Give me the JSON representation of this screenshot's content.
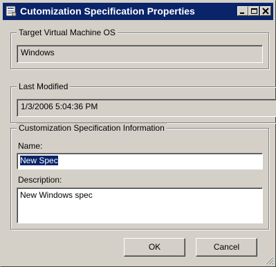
{
  "window": {
    "title": "Cutomization Specification Properties",
    "icon": "properties-window-icon",
    "controls": {
      "minimize": "minimize-icon",
      "maximize": "maximize-icon",
      "close": "close-icon"
    }
  },
  "target_os": {
    "legend": "Target Virtual Machine OS",
    "value": "Windows"
  },
  "last_modified": {
    "legend": "Last Modified",
    "value": "1/3/2006 5:04:36 PM"
  },
  "spec_info": {
    "legend": "Customization Specification Information",
    "name_label": "Name:",
    "name_value": "New Spec",
    "description_label": "Description:",
    "description_value": "New Windows spec"
  },
  "buttons": {
    "ok": "OK",
    "cancel": "Cancel"
  },
  "colors": {
    "titlebar": "#0a246a",
    "face": "#d4d0c8",
    "selection": "#0a246a"
  }
}
